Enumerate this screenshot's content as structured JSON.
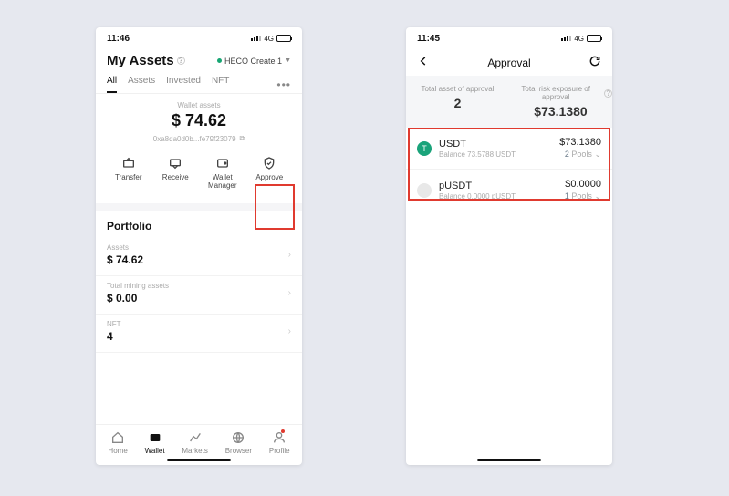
{
  "left": {
    "status": {
      "time": "11:46",
      "net": "4G"
    },
    "title": "My Assets",
    "network": "HECO Create 1",
    "tabs": {
      "all": "All",
      "assets": "Assets",
      "invested": "Invested",
      "nft": "NFT"
    },
    "wallet_label": "Wallet assets",
    "balance": "$ 74.62",
    "address": "0xa8da0d0b...fe79f23079",
    "actions": {
      "transfer": "Transfer",
      "receive": "Receive",
      "wallet_manager": "Wallet\nManager",
      "approve": "Approve"
    },
    "portfolio": {
      "title": "Portfolio",
      "assets_label": "Assets",
      "assets_value": "$ 74.62",
      "mining_label": "Total mining assets",
      "mining_value": "$ 0.00",
      "nft_label": "NFT",
      "nft_value": "4"
    },
    "nav": {
      "home": "Home",
      "wallet": "Wallet",
      "markets": "Markets",
      "browser": "Browser",
      "profile": "Profile"
    }
  },
  "right": {
    "status": {
      "time": "11:45",
      "net": "4G"
    },
    "title": "Approval",
    "summary": {
      "count_label": "Total asset of approval",
      "count_value": "2",
      "risk_label": "Total risk exposure of approval",
      "risk_value": "$73.1380"
    },
    "tokens": [
      {
        "name": "USDT",
        "sub": "Balance 73.5788 USDT",
        "value": "$73.1380",
        "pools_n": "2",
        "pools_t": " Pools"
      },
      {
        "name": "pUSDT",
        "sub": "Balance 0.0000 pUSDT",
        "value": "$0.0000",
        "pools_n": "1",
        "pools_t": " Pools"
      }
    ]
  }
}
